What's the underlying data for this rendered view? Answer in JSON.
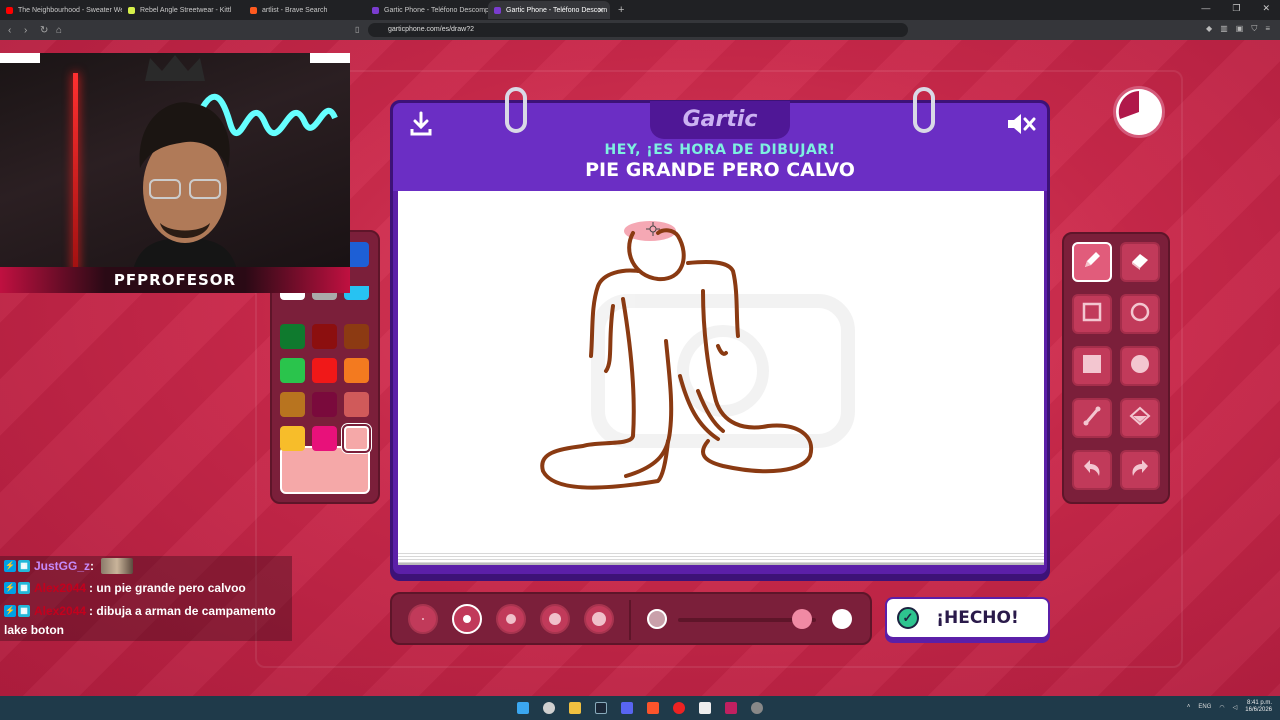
{
  "browser": {
    "tabs": [
      {
        "title": "The Neighbourhood - Sweater Weat",
        "color": "#ff0000"
      },
      {
        "title": "Rebel Angle Streetwear - Kittl",
        "color": "#d6f04a"
      },
      {
        "title": "artlist - Brave Search",
        "color": "#ff5a1f"
      },
      {
        "title": "Gartic Phone - Teléfono Descompu",
        "color": "#7a3ccf"
      },
      {
        "title": "Gartic Phone - Teléfono Descom",
        "color": "#7a3ccf",
        "active": true
      }
    ],
    "url": "garticphone.com/es/draw?2"
  },
  "stream": {
    "streamer_name": "PFPROFESOR"
  },
  "game": {
    "logo": "Gartic",
    "subtitle": "HEY, ¡ES HORA DE DIBUJAR!",
    "phrase": "PIE GRANDE PERO CALVO",
    "done_label": "¡HECHO!",
    "download_icon": "download-icon",
    "mute_icon": "speaker-muted-icon",
    "timer_icon": "timer-icon",
    "palette": {
      "colors": [
        [
          "#ffffff",
          "#aaaaaa",
          "#27c2f2"
        ],
        [
          "#0f7a2e",
          "#8c0f0f",
          "#8c3a12"
        ],
        [
          "#2ac44c",
          "#f01818",
          "#f37a1f"
        ],
        [
          "#b8741f",
          "#7a0a3c",
          "#d05a5a"
        ],
        [
          "#f7bd2a",
          "#e8117a",
          "#f5a8a8"
        ]
      ],
      "top_partial": "#1d5fd6",
      "selected": "#f5a8a8",
      "current": "#f5a8a8"
    },
    "tools": [
      "pencil",
      "eraser",
      "rectangle-outline",
      "circle-outline",
      "rectangle-filled",
      "circle-filled",
      "line",
      "fill-bucket",
      "undo",
      "redo"
    ],
    "active_tool": "pencil",
    "brush_sizes": [
      1,
      2,
      3,
      4,
      5
    ],
    "selected_size": 2,
    "opacity": 0.9
  },
  "chat": {
    "messages": [
      {
        "user": "JustGG_z",
        "text": "",
        "user_color": "purple",
        "emote": true
      },
      {
        "user": "Alex2044",
        "text": ": un pie grande pero calvoo",
        "user_color": "red"
      },
      {
        "user": "Alex2044",
        "text": ": dibuja a arman de campamento",
        "user_color": "red"
      }
    ],
    "continuation": "lake boton"
  },
  "taskbar": {
    "language": "ENG",
    "time": "8:41 p.m.",
    "date": "16/6/2026"
  }
}
